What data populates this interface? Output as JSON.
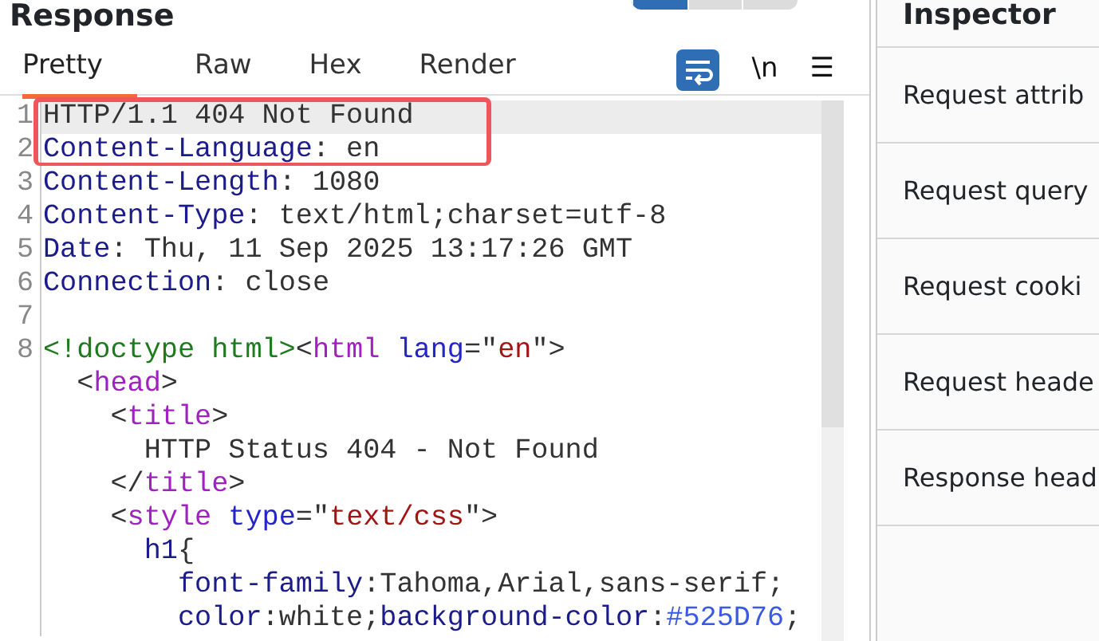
{
  "response": {
    "title": "Response",
    "layout_toggle": [
      {
        "selected": true
      },
      {
        "selected": false
      },
      {
        "selected": false
      }
    ],
    "tabs": [
      {
        "label": "Pretty",
        "selected": true
      },
      {
        "label": "Raw",
        "selected": false
      },
      {
        "label": "Hex",
        "selected": false
      },
      {
        "label": "Render",
        "selected": false
      }
    ],
    "toolbar": {
      "wrap_on": true,
      "newline_label": "\\n",
      "menu_label": "☰"
    },
    "lines": [
      {
        "number": "1",
        "highlighted": true,
        "rows": [
          {
            "tokens": [
              {
                "kind": "plain",
                "text": "HTTP/1.1 404 Not Found"
              }
            ]
          }
        ]
      },
      {
        "number": "2",
        "highlighted": false,
        "rows": [
          {
            "tokens": [
              {
                "kind": "key",
                "text": "Content-Language"
              },
              {
                "kind": "plain",
                "text": ": en"
              }
            ]
          }
        ]
      },
      {
        "number": "3",
        "highlighted": false,
        "rows": [
          {
            "tokens": [
              {
                "kind": "key",
                "text": "Content-Length"
              },
              {
                "kind": "plain",
                "text": ": 1080"
              }
            ]
          }
        ]
      },
      {
        "number": "4",
        "highlighted": false,
        "rows": [
          {
            "tokens": [
              {
                "kind": "key",
                "text": "Content-Type"
              },
              {
                "kind": "plain",
                "text": ": text/html;charset=utf-8"
              }
            ]
          }
        ]
      },
      {
        "number": "5",
        "highlighted": false,
        "rows": [
          {
            "tokens": [
              {
                "kind": "key",
                "text": "Date"
              },
              {
                "kind": "plain",
                "text": ": Thu, 11 Sep 2025 13:17:26 GMT"
              }
            ]
          }
        ]
      },
      {
        "number": "6",
        "highlighted": false,
        "rows": [
          {
            "tokens": [
              {
                "kind": "key",
                "text": "Connection"
              },
              {
                "kind": "plain",
                "text": ": close"
              }
            ]
          }
        ]
      },
      {
        "number": "7",
        "highlighted": false
      },
      {
        "number": "8",
        "highlighted": false,
        "rows": [
          {
            "tokens": [
              {
                "kind": "doctype",
                "text": "<!doctype html>"
              },
              {
                "kind": "plain",
                "text": "<"
              },
              {
                "kind": "tag",
                "text": "html"
              },
              {
                "kind": "attr",
                "text": " lang"
              },
              {
                "kind": "plain",
                "text": "=\""
              },
              {
                "kind": "string",
                "text": "en"
              },
              {
                "kind": "plain",
                "text": "\">"
              }
            ]
          },
          {
            "tokens": [
              {
                "kind": "plain",
                "text": "  <"
              },
              {
                "kind": "tag",
                "text": "head"
              },
              {
                "kind": "plain",
                "text": ">"
              }
            ]
          },
          {
            "tokens": [
              {
                "kind": "plain",
                "text": "    <"
              },
              {
                "kind": "tag",
                "text": "title"
              },
              {
                "kind": "plain",
                "text": ">"
              }
            ]
          },
          {
            "tokens": [
              {
                "kind": "plain",
                "text": "      HTTP Status 404 - Not Found"
              }
            ]
          },
          {
            "tokens": [
              {
                "kind": "plain",
                "text": "    </"
              },
              {
                "kind": "tag",
                "text": "title"
              },
              {
                "kind": "plain",
                "text": ">"
              }
            ]
          },
          {
            "tokens": [
              {
                "kind": "plain",
                "text": "    <"
              },
              {
                "kind": "tag",
                "text": "style"
              },
              {
                "kind": "attr",
                "text": " type"
              },
              {
                "kind": "plain",
                "text": "=\""
              },
              {
                "kind": "string",
                "text": "text/css"
              },
              {
                "kind": "plain",
                "text": "\">"
              }
            ]
          },
          {
            "tokens": [
              {
                "kind": "key",
                "text": "      h1"
              },
              {
                "kind": "plain",
                "text": "{"
              }
            ]
          },
          {
            "tokens": [
              {
                "kind": "key",
                "text": "        font-family"
              },
              {
                "kind": "plain",
                "text": ":Tahoma,Arial,sans-serif;"
              }
            ]
          },
          {
            "tokens": [
              {
                "kind": "key",
                "text": "        color"
              },
              {
                "kind": "plain",
                "text": ":white;"
              },
              {
                "kind": "key",
                "text": "background-color"
              },
              {
                "kind": "plain",
                "text": ":"
              },
              {
                "kind": "hex",
                "text": "#525D76"
              },
              {
                "kind": "plain",
                "text": ";"
              }
            ]
          }
        ]
      }
    ]
  },
  "inspector": {
    "title": "Inspector",
    "items": [
      "Request attrib",
      "Request query",
      "Request cooki",
      "Request heade",
      "Response head"
    ]
  }
}
